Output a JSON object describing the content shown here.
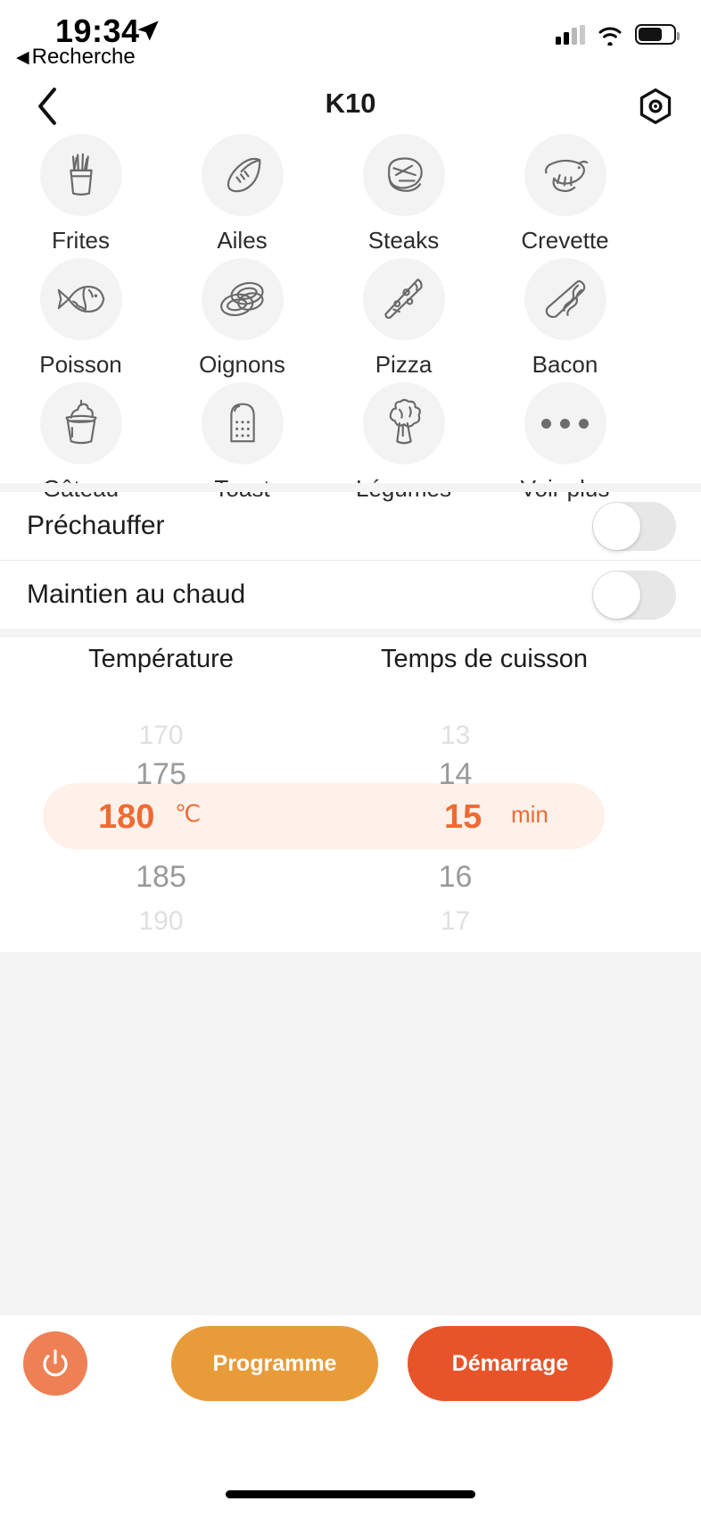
{
  "status_bar": {
    "time": "19:34",
    "back_app_label": "Recherche",
    "back_triangle": "◀",
    "icons": [
      "location-arrow-icon",
      "cellular-signal-icon",
      "wifi-icon",
      "battery-icon"
    ]
  },
  "nav": {
    "title": "K10",
    "back_icon": "chevron-left-icon",
    "settings_icon": "hexagon-settings-icon"
  },
  "presets": [
    {
      "label": "Frites",
      "icon": "fries-icon"
    },
    {
      "label": "Ailes",
      "icon": "chicken-wing-icon"
    },
    {
      "label": "Steaks",
      "icon": "steak-icon"
    },
    {
      "label": "Crevette",
      "icon": "shrimp-icon"
    },
    {
      "label": "Poisson",
      "icon": "fish-icon"
    },
    {
      "label": "Oignons",
      "icon": "onion-rings-icon"
    },
    {
      "label": "Pizza",
      "icon": "pizza-slice-icon"
    },
    {
      "label": "Bacon",
      "icon": "bacon-icon"
    },
    {
      "label": "Gâteau",
      "icon": "cupcake-icon"
    },
    {
      "label": "Toast",
      "icon": "bread-slice-icon"
    },
    {
      "label": "Légumes",
      "icon": "broccoli-icon"
    },
    {
      "label": "Voir plus",
      "icon": "more-dots-icon"
    }
  ],
  "toggles": [
    {
      "label": "Préchauffer",
      "state": "off"
    },
    {
      "label": "Maintien au chaud",
      "state": "off"
    }
  ],
  "picker": {
    "temperature": {
      "header": "Température",
      "unit": "℃",
      "selected": "180",
      "options": [
        "170",
        "175",
        "180",
        "185",
        "190"
      ]
    },
    "cooking_time": {
      "header": "Temps de cuisson",
      "unit": "min",
      "selected": "15",
      "options": [
        "13",
        "14",
        "15",
        "16",
        "17"
      ]
    }
  },
  "actions": {
    "power_icon": "power-icon",
    "program_label": "Programme",
    "start_label": "Démarrage"
  },
  "colors": {
    "accent_orange": "#ef6a33",
    "program_amber": "#e89b39",
    "start_red_orange": "#e8542a",
    "power_salmon": "#ee8055",
    "selection_pill": "#fdf1ea",
    "disc_gray": "#f3f3f3",
    "band_gray": "#f4f4f4"
  }
}
